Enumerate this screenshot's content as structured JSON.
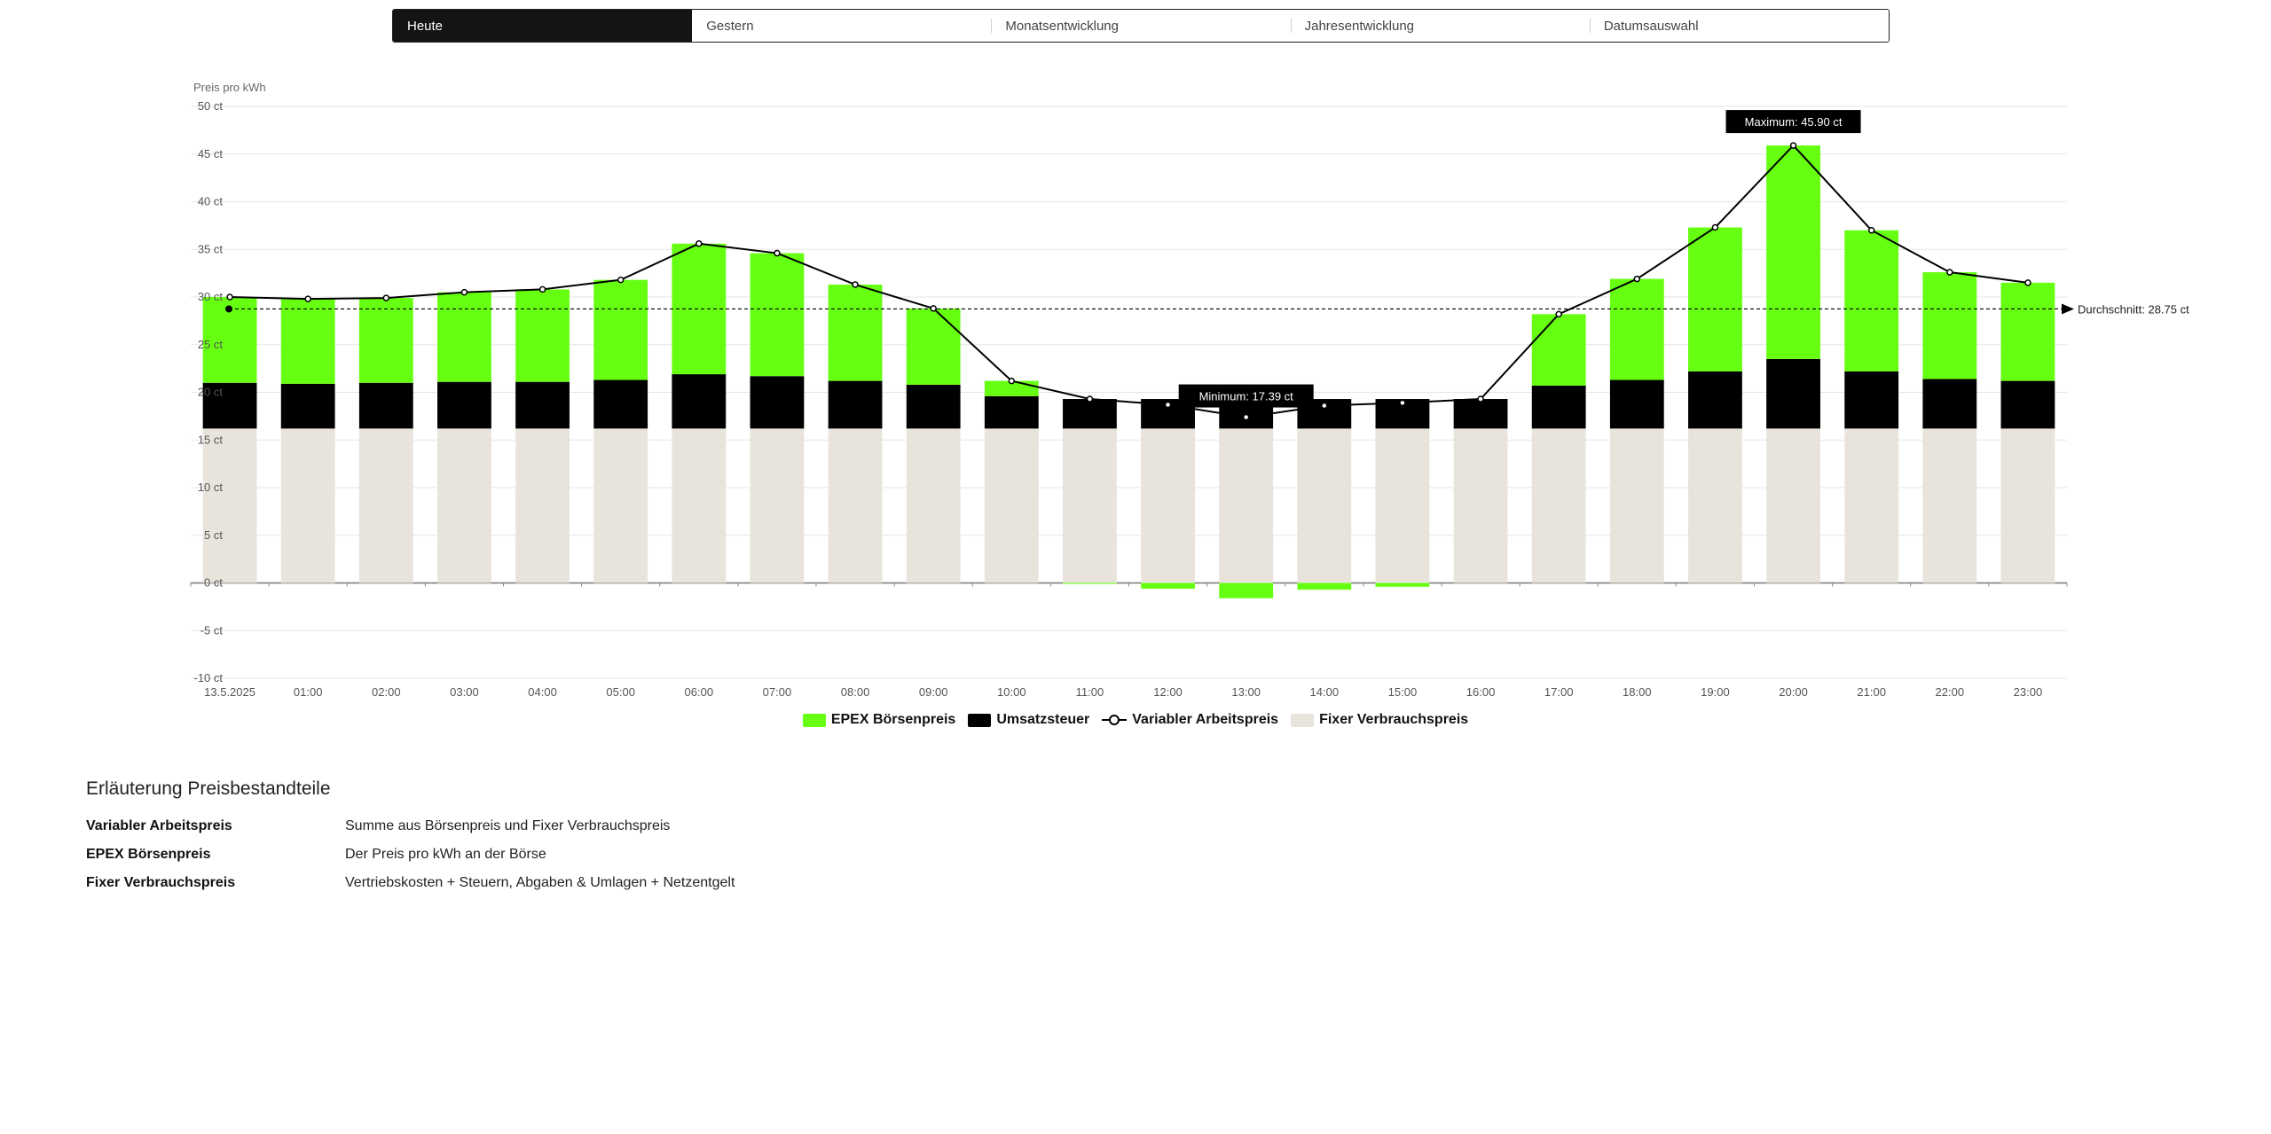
{
  "tabs": [
    {
      "label": "Heute",
      "active": true
    },
    {
      "label": "Gestern",
      "active": false
    },
    {
      "label": "Monatsentwicklung",
      "active": false
    },
    {
      "label": "Jahresentwicklung",
      "active": false
    },
    {
      "label": "Datumsauswahl",
      "active": false
    }
  ],
  "colors": {
    "epex": "#66ff11",
    "tax": "#000000",
    "fixed": "#e8e4dc",
    "line": "#000000"
  },
  "chart_data": {
    "type": "bar",
    "stacked": true,
    "ylabel": "Preis pro kWh",
    "unit": "ct",
    "ylim": [
      -10,
      50
    ],
    "yticks": [
      -10,
      -5,
      0,
      5,
      10,
      15,
      20,
      25,
      30,
      35,
      40,
      45,
      50
    ],
    "grid": true,
    "categories": [
      "13.5.2025",
      "01:00",
      "02:00",
      "03:00",
      "04:00",
      "05:00",
      "06:00",
      "07:00",
      "08:00",
      "09:00",
      "10:00",
      "11:00",
      "12:00",
      "13:00",
      "14:00",
      "15:00",
      "16:00",
      "17:00",
      "18:00",
      "19:00",
      "20:00",
      "21:00",
      "22:00",
      "23:00"
    ],
    "series": [
      {
        "name": "Fixer Verbrauchspreis",
        "values": [
          16.2,
          16.2,
          16.2,
          16.2,
          16.2,
          16.2,
          16.2,
          16.2,
          16.2,
          16.2,
          16.2,
          16.2,
          16.2,
          16.2,
          16.2,
          16.2,
          16.2,
          16.2,
          16.2,
          16.2,
          16.2,
          16.2,
          16.2,
          16.2
        ]
      },
      {
        "name": "Umsatzsteuer",
        "values": [
          4.8,
          4.7,
          4.8,
          4.9,
          4.9,
          5.1,
          5.7,
          5.5,
          5.0,
          4.6,
          3.4,
          3.1,
          3.1,
          3.0,
          3.1,
          3.1,
          3.1,
          4.5,
          5.1,
          6.0,
          7.3,
          6.0,
          5.2,
          5.0
        ]
      },
      {
        "name": "EPEX Börsenpreis",
        "values": [
          9.0,
          8.9,
          8.9,
          9.4,
          9.7,
          10.5,
          13.7,
          12.9,
          10.1,
          8.0,
          1.6,
          -0.1,
          -0.6,
          -1.6,
          -0.7,
          -0.4,
          0.0,
          7.5,
          10.6,
          15.1,
          22.4,
          14.8,
          11.2,
          10.3
        ]
      },
      {
        "name": "Variabler Arbeitspreis",
        "type": "line",
        "values": [
          30.0,
          29.8,
          29.9,
          30.5,
          30.8,
          31.8,
          35.6,
          34.6,
          31.3,
          28.8,
          21.2,
          19.3,
          18.7,
          17.39,
          18.6,
          18.9,
          19.3,
          28.2,
          31.9,
          37.3,
          45.9,
          37.0,
          32.6,
          31.5
        ]
      }
    ],
    "annotations": {
      "max_label": "Maximum: 45.90 ct",
      "min_label": "Minimum: 17.39 ct",
      "avg_label": "Durchschnitt: 28.75 ct",
      "avg_value": 28.75
    },
    "legend": {
      "placement": "bottom",
      "items": [
        "EPEX Börsenpreis",
        "Umsatzsteuer",
        "Variabler Arbeitspreis",
        "Fixer Verbrauchspreis"
      ]
    }
  },
  "explanation": {
    "title": "Erläuterung Preisbestandteile",
    "rows": [
      {
        "term": "Variabler Arbeitspreis",
        "desc": "Summe aus Börsenpreis und Fixer Verbrauchspreis"
      },
      {
        "term": "EPEX Börsenpreis",
        "desc": "Der Preis pro kWh an der Börse"
      },
      {
        "term": "Fixer Verbrauchspreis",
        "desc": "Vertriebskosten + Steuern, Abgaben & Umlagen + Netzentgelt"
      }
    ]
  }
}
